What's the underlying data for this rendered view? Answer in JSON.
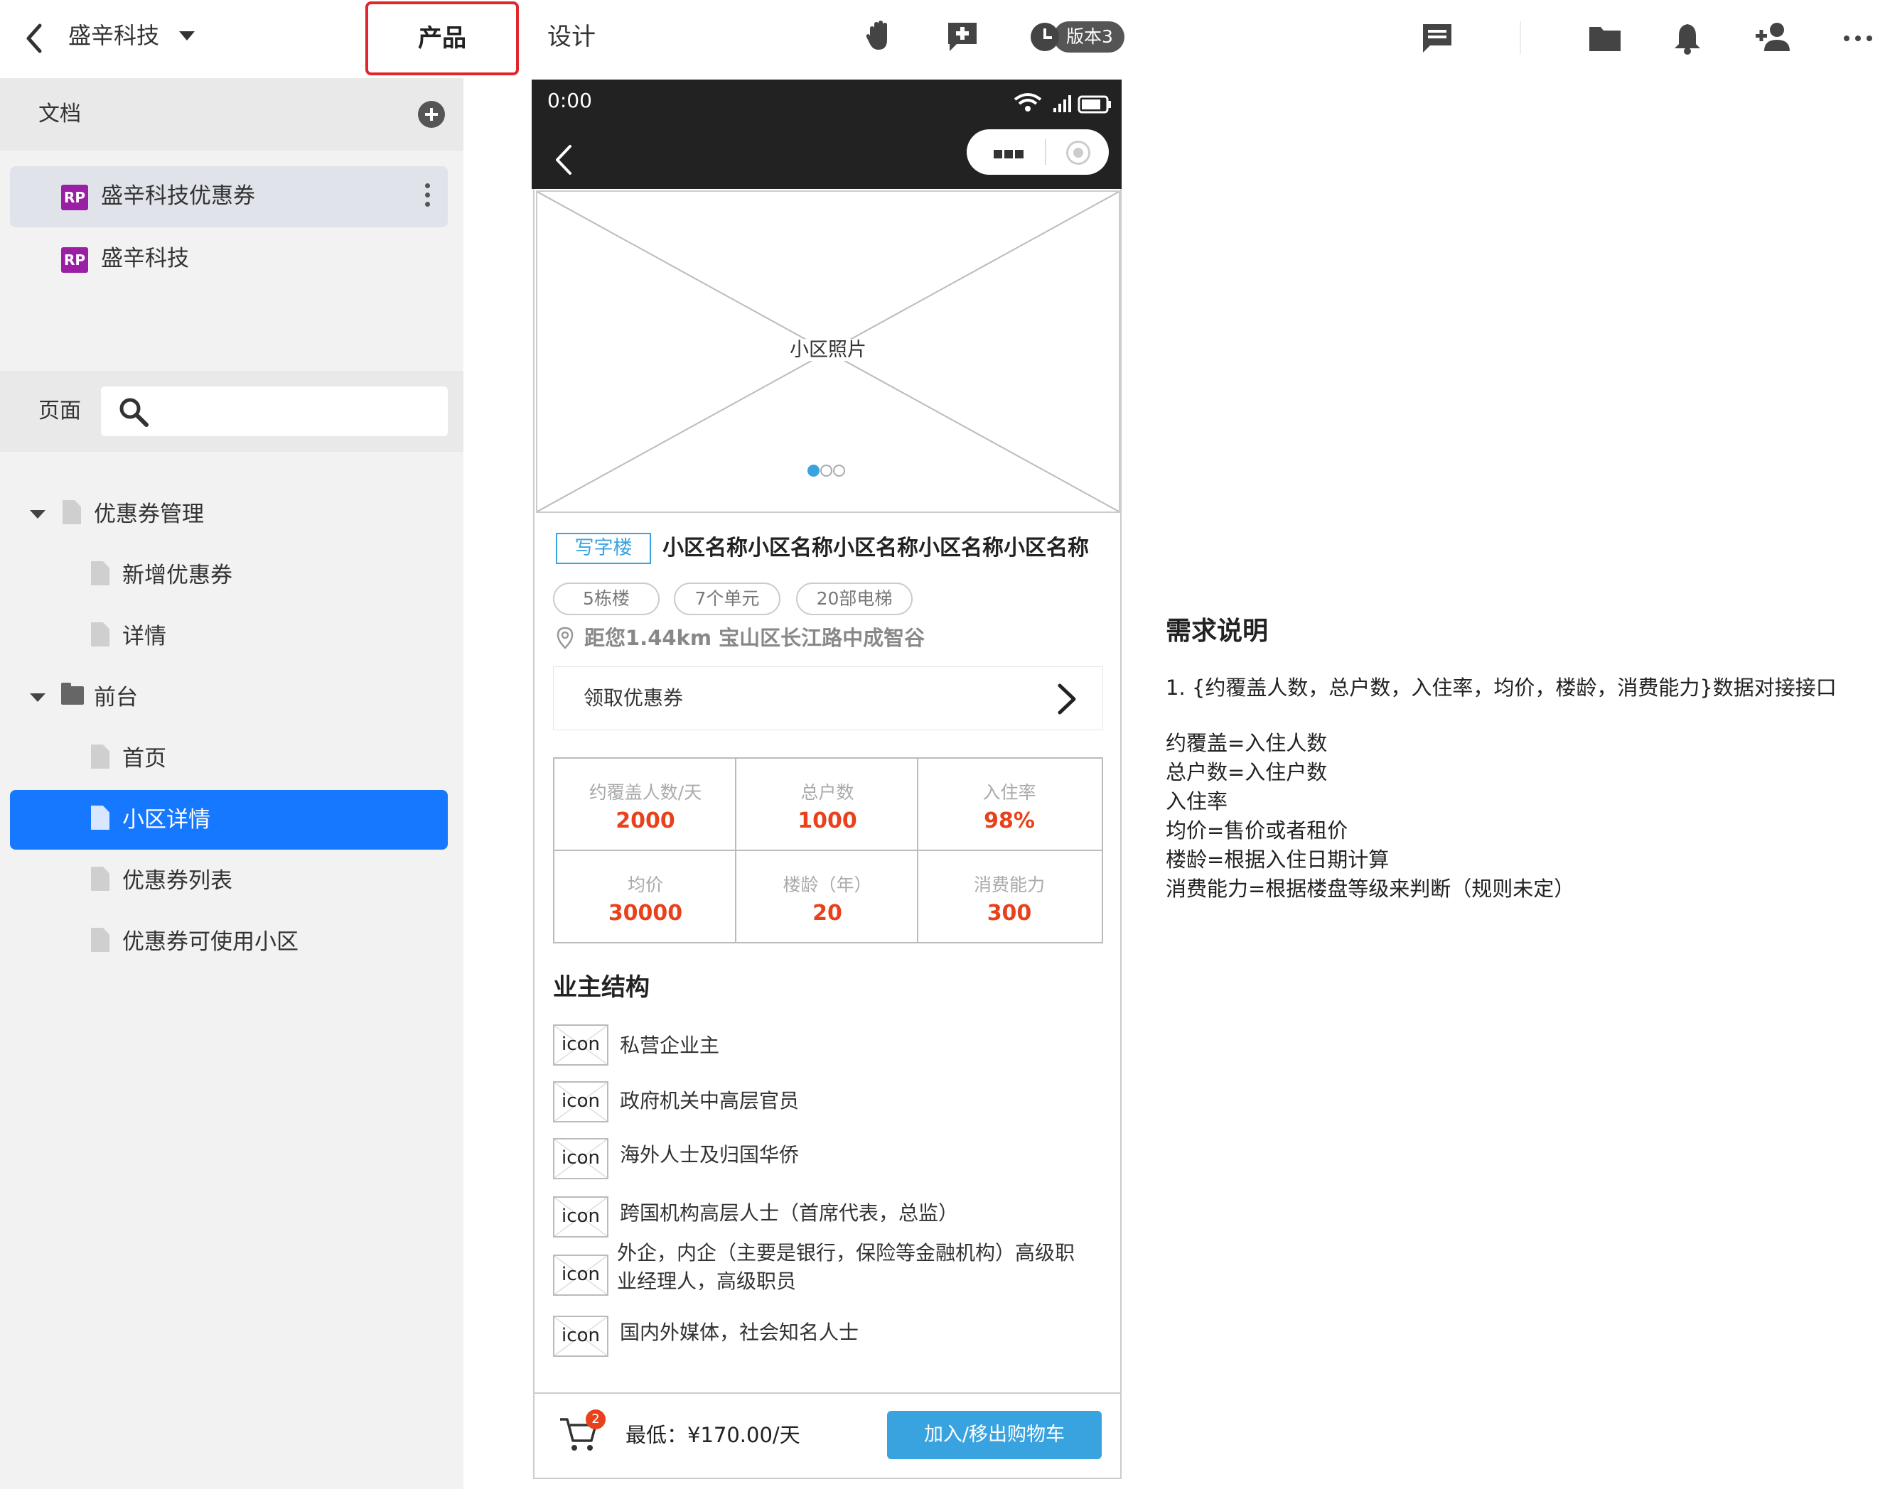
{
  "topbar": {
    "project_name": "盛辛科技",
    "tabs": [
      {
        "label": "产品",
        "selected": true
      },
      {
        "label": "设计",
        "selected": false
      }
    ],
    "version_label": "版本3"
  },
  "sidebar": {
    "docs_label": "文档",
    "docs": [
      {
        "badge": "RP",
        "label": "盛辛科技优惠券",
        "active": true
      },
      {
        "badge": "RP",
        "label": "盛辛科技",
        "active": false
      }
    ],
    "pages_label": "页面",
    "search_placeholder": "",
    "tree": [
      {
        "label": "优惠券管理",
        "type": "page",
        "expanded": true
      },
      {
        "label": "新增优惠券",
        "type": "page"
      },
      {
        "label": "详情",
        "type": "page"
      },
      {
        "label": "前台",
        "type": "folder",
        "expanded": true
      },
      {
        "label": "首页",
        "type": "page"
      },
      {
        "label": "小区详情",
        "type": "page",
        "selected": true
      },
      {
        "label": "优惠券列表",
        "type": "page"
      },
      {
        "label": "优惠券可使用小区",
        "type": "page"
      }
    ]
  },
  "phone": {
    "status_time": "0:00",
    "photo_label": "小区照片",
    "carousel": {
      "pages": 3,
      "current": 1
    },
    "tag": "写字楼",
    "estate_name": "小区名称小区名称小区名称小区名称小区名称",
    "chips": [
      "5栋楼",
      "7个单元",
      "20部电梯"
    ],
    "location": "距您1.44km 宝山区长江路中成智谷",
    "coupon_link": "领取优惠券",
    "stats": [
      {
        "label": "约覆盖人数/天",
        "value": "2000"
      },
      {
        "label": "总户数",
        "value": "1000"
      },
      {
        "label": "入住率",
        "value": "98%"
      },
      {
        "label": "均价",
        "value": "30000"
      },
      {
        "label": "楼龄（年）",
        "value": "20"
      },
      {
        "label": "消费能力",
        "value": "300"
      }
    ],
    "owner_title": "业主结构",
    "icon_placeholder": "icon",
    "owners": [
      {
        "line1": "私营企业主",
        "line2": ""
      },
      {
        "line1": "政府机关中高层官员",
        "line2": ""
      },
      {
        "line1": "海外人士及归国华侨",
        "line2": ""
      },
      {
        "line1": "跨国机构高层人士（首席代表，总监）",
        "line2": ""
      },
      {
        "line1": "外企，内企（主要是银行，保险等金融机构）高级职",
        "line2": "业经理人，高级职员"
      },
      {
        "line1": "国内外媒体，社会知名人士",
        "line2": ""
      }
    ],
    "cart_count": "2",
    "price": "最低：¥170.00/天",
    "cart_button": "加入/移出购物车"
  },
  "requirements": {
    "title": "需求说明",
    "lines": [
      "1. {约覆盖人数，总户数，入住率，均价，楼龄，消费能力}数据对接接口",
      "约覆盖=入住人数",
      "总户数=入住户数",
      "入住率",
      "均价=售价或者租价",
      "楼龄=根据入住日期计算",
      "消费能力=根据楼盘等级来判断（规则未定）"
    ]
  },
  "colors": {
    "accent_blue": "#1677ff",
    "proto_blue": "#39a3e0",
    "value_red": "#e8411b",
    "highlight_red": "#e0262a",
    "rp_purple": "#9a1fa5"
  }
}
